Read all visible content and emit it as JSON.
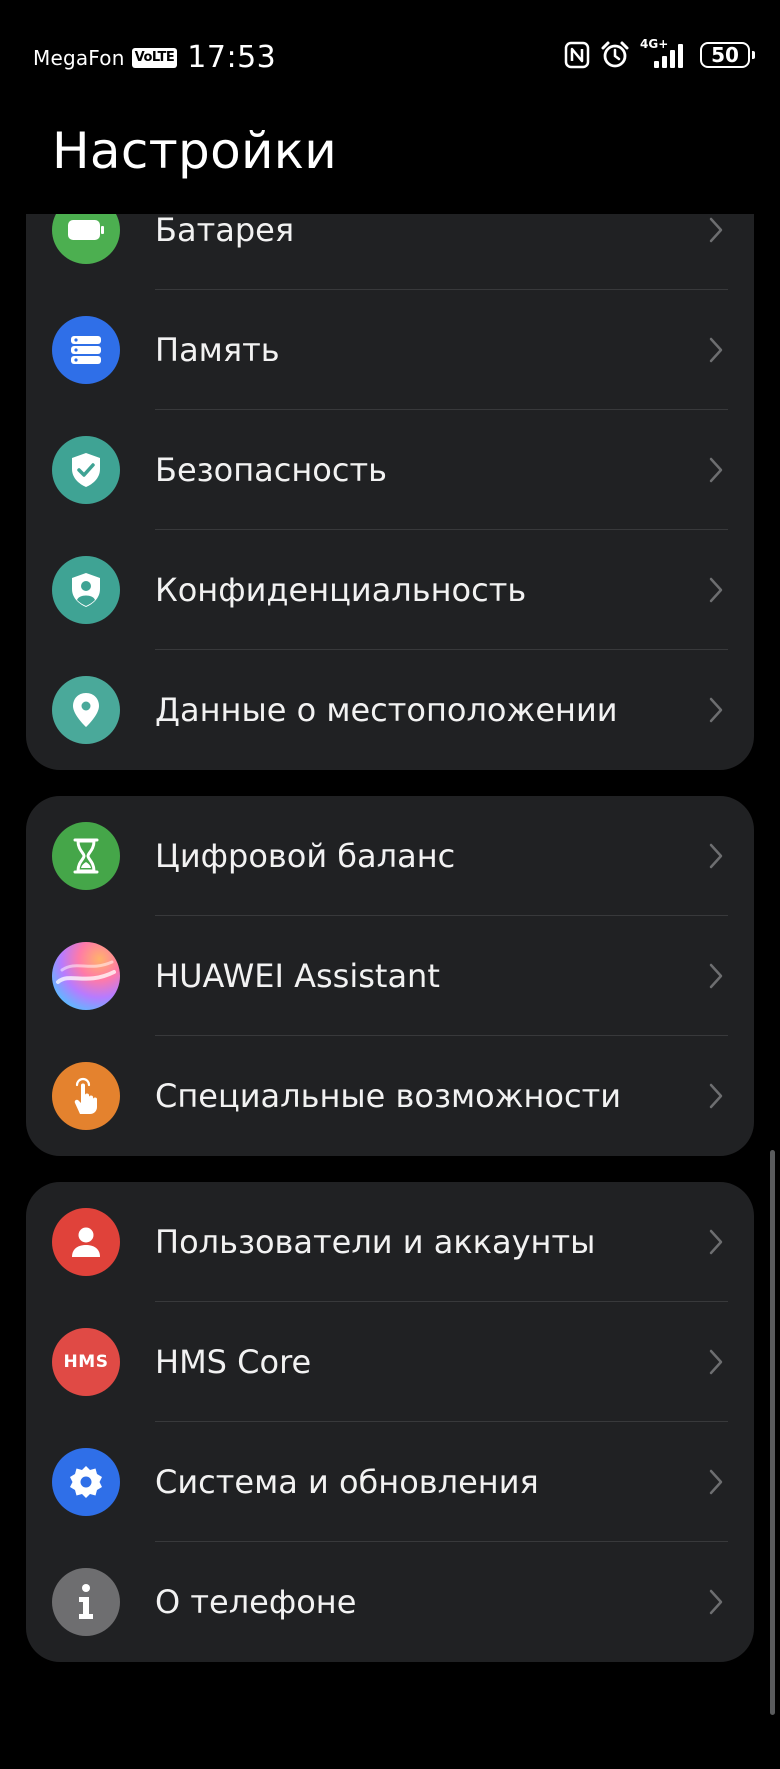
{
  "status_bar": {
    "carrier": "MegaFon",
    "volte": "VoLTE",
    "time": "17:53",
    "network": "4G+",
    "battery": "50"
  },
  "title": "Настройки",
  "colors": {
    "background": "#000000",
    "card": "#202123",
    "battery_green": "#4caf50",
    "storage_blue": "#2f6fe8",
    "security_teal": "#3fa394",
    "location_teal": "#4aa99a",
    "balance_green": "#45a649",
    "accessibility_orange": "#e4822e",
    "accounts_red": "#e0423a",
    "hms_red": "#e04a45",
    "system_blue": "#2f6fe8",
    "about_gray": "#6e6e70"
  },
  "groups": [
    {
      "items": [
        {
          "label": "Батарея",
          "icon": "battery-icon"
        },
        {
          "label": "Память",
          "icon": "storage-icon"
        },
        {
          "label": "Безопасность",
          "icon": "shield-check-icon"
        },
        {
          "label": "Конфиденциальность",
          "icon": "privacy-icon"
        },
        {
          "label": "Данные о местоположении",
          "icon": "location-pin-icon"
        }
      ]
    },
    {
      "items": [
        {
          "label": "Цифровой баланс",
          "icon": "hourglass-icon"
        },
        {
          "label": "HUAWEI Assistant",
          "icon": "huawei-assistant-icon"
        },
        {
          "label": "Специальные возможности",
          "icon": "hand-pointer-icon"
        }
      ]
    },
    {
      "items": [
        {
          "label": "Пользователи и аккаунты",
          "icon": "user-icon"
        },
        {
          "label": "HMS Core",
          "icon": "hms-core-icon",
          "icon_text": "HMS"
        },
        {
          "label": "Система и обновления",
          "icon": "gear-icon"
        },
        {
          "label": "О телефоне",
          "icon": "info-icon"
        }
      ]
    }
  ]
}
